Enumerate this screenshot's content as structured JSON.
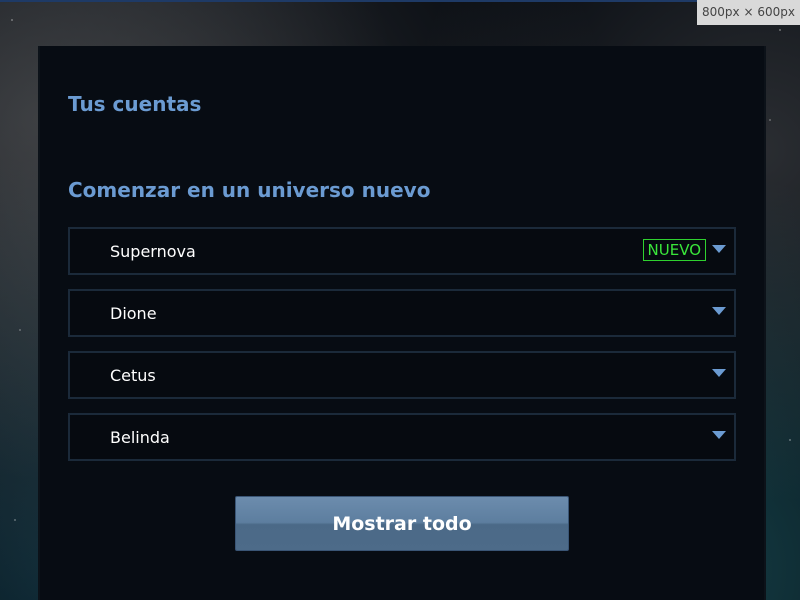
{
  "viewport_label": "800px × 600px",
  "accounts": {
    "title": "Tus cuentas"
  },
  "universes": {
    "title": "Comenzar en un universo nuevo",
    "items": [
      {
        "name": "Supernova",
        "badge": "NUEVO"
      },
      {
        "name": "Dione"
      },
      {
        "name": "Cetus"
      },
      {
        "name": "Belinda"
      }
    ]
  },
  "show_all_label": "Mostrar todo",
  "colors": {
    "heading": "#6b9bd2",
    "badge": "#3ae63a",
    "panel_bg": "#070c13",
    "button": "#5d7e9f"
  },
  "icons": {
    "row_toggle": "chevron-down-icon"
  }
}
